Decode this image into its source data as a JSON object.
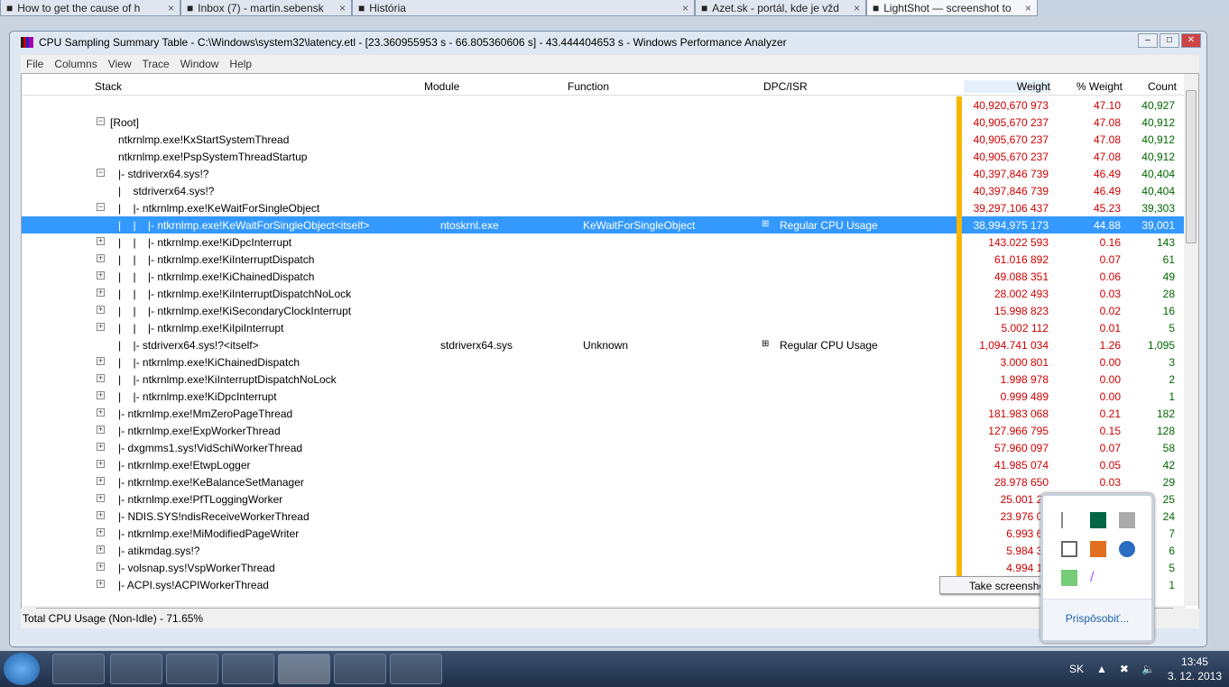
{
  "browser_tabs": [
    "How to get the cause of h",
    "Inbox (7) - martin.sebensk",
    "História",
    "Azet.sk - portál, kde je vžd",
    "LightShot — screenshot to"
  ],
  "window": {
    "title": "CPU Sampling Summary Table - C:\\Windows\\system32\\latency.etl - [23.360955953 s - 66.805360606 s] - 43.444404653 s - Windows Performance Analyzer"
  },
  "menu": [
    "File",
    "Columns",
    "View",
    "Trace",
    "Window",
    "Help"
  ],
  "columns": {
    "stack": "Stack",
    "module": "Module",
    "function": "Function",
    "dpc": "DPC/ISR",
    "weight": "Weight",
    "pweight": "% Weight",
    "count": "Count"
  },
  "rows": [
    {
      "exp": "",
      "stack": "",
      "module": "",
      "function": "",
      "dpc": "",
      "weight": "40,920,670 973",
      "pweight": "47.10",
      "count": "40,927"
    },
    {
      "exp": "−",
      "stack": "[Root]",
      "module": "",
      "function": "",
      "dpc": "",
      "weight": "40,905,670 237",
      "pweight": "47.08",
      "count": "40,912"
    },
    {
      "exp": "",
      "stack": "ntkrnlmp.exe!KxStartSystemThread",
      "module": "",
      "function": "",
      "dpc": "",
      "weight": "40,905,670 237",
      "pweight": "47.08",
      "count": "40,912"
    },
    {
      "exp": "",
      "stack": "ntkrnlmp.exe!PspSystemThreadStartup",
      "module": "",
      "function": "",
      "dpc": "",
      "weight": "40,905,670 237",
      "pweight": "47.08",
      "count": "40,912"
    },
    {
      "exp": "−",
      "stack": "|- stdriverx64.sys!?",
      "module": "",
      "function": "",
      "dpc": "",
      "weight": "40,397,846 739",
      "pweight": "46.49",
      "count": "40,404"
    },
    {
      "exp": "",
      "stack": "|    stdriverx64.sys!?",
      "module": "",
      "function": "",
      "dpc": "",
      "weight": "40,397,846 739",
      "pweight": "46.49",
      "count": "40,404"
    },
    {
      "exp": "−",
      "stack": "|    |- ntkrnlmp.exe!KeWaitForSingleObject",
      "module": "",
      "function": "",
      "dpc": "",
      "weight": "39,297,106 437",
      "pweight": "45.23",
      "count": "39,303"
    },
    {
      "exp": "",
      "stack": "|    |    |- ntkrnlmp.exe!KeWaitForSingleObject<itself>",
      "module": "ntoskrnl.exe",
      "function": "KeWaitForSingleObject",
      "dpc": "Regular CPU Usage",
      "weight": "38,994,975 173",
      "pweight": "44.88",
      "count": "39,001",
      "selected": true
    },
    {
      "exp": "+",
      "stack": "|    |    |- ntkrnlmp.exe!KiDpcInterrupt",
      "module": "",
      "function": "",
      "dpc": "",
      "weight": "143.022 593",
      "pweight": "0.16",
      "count": "143"
    },
    {
      "exp": "+",
      "stack": "|    |    |- ntkrnlmp.exe!KiInterruptDispatch",
      "module": "",
      "function": "",
      "dpc": "",
      "weight": "61.016 892",
      "pweight": "0.07",
      "count": "61"
    },
    {
      "exp": "+",
      "stack": "|    |    |- ntkrnlmp.exe!KiChainedDispatch",
      "module": "",
      "function": "",
      "dpc": "",
      "weight": "49.088 351",
      "pweight": "0.06",
      "count": "49"
    },
    {
      "exp": "+",
      "stack": "|    |    |- ntkrnlmp.exe!KiInterruptDispatchNoLock",
      "module": "",
      "function": "",
      "dpc": "",
      "weight": "28.002 493",
      "pweight": "0.03",
      "count": "28"
    },
    {
      "exp": "+",
      "stack": "|    |    |- ntkrnlmp.exe!KiSecondaryClockInterrupt",
      "module": "",
      "function": "",
      "dpc": "",
      "weight": "15.998 823",
      "pweight": "0.02",
      "count": "16"
    },
    {
      "exp": "+",
      "stack": "|    |    |- ntkrnlmp.exe!KiIpiInterrupt",
      "module": "",
      "function": "",
      "dpc": "",
      "weight": "5.002 112",
      "pweight": "0.01",
      "count": "5"
    },
    {
      "exp": "",
      "stack": "|    |- stdriverx64.sys!?<itself>",
      "module": "stdriverx64.sys",
      "function": "Unknown",
      "dpc": "Regular CPU Usage",
      "weight": "1,094.741 034",
      "pweight": "1.26",
      "count": "1,095"
    },
    {
      "exp": "+",
      "stack": "|    |- ntkrnlmp.exe!KiChainedDispatch",
      "module": "",
      "function": "",
      "dpc": "",
      "weight": "3.000 801",
      "pweight": "0.00",
      "count": "3"
    },
    {
      "exp": "+",
      "stack": "|    |- ntkrnlmp.exe!KiInterruptDispatchNoLock",
      "module": "",
      "function": "",
      "dpc": "",
      "weight": "1.998 978",
      "pweight": "0.00",
      "count": "2"
    },
    {
      "exp": "+",
      "stack": "|    |- ntkrnlmp.exe!KiDpcInterrupt",
      "module": "",
      "function": "",
      "dpc": "",
      "weight": "0.999 489",
      "pweight": "0.00",
      "count": "1"
    },
    {
      "exp": "+",
      "stack": "|- ntkrnlmp.exe!MmZeroPageThread",
      "module": "",
      "function": "",
      "dpc": "",
      "weight": "181.983 068",
      "pweight": "0.21",
      "count": "182"
    },
    {
      "exp": "+",
      "stack": "|- ntkrnlmp.exe!ExpWorkerThread",
      "module": "",
      "function": "",
      "dpc": "",
      "weight": "127.966 795",
      "pweight": "0.15",
      "count": "128"
    },
    {
      "exp": "+",
      "stack": "|- dxgmms1.sys!VidSchiWorkerThread",
      "module": "",
      "function": "",
      "dpc": "",
      "weight": "57.960 097",
      "pweight": "0.07",
      "count": "58"
    },
    {
      "exp": "+",
      "stack": "|- ntkrnlmp.exe!EtwpLogger",
      "module": "",
      "function": "",
      "dpc": "",
      "weight": "41.985 074",
      "pweight": "0.05",
      "count": "42"
    },
    {
      "exp": "+",
      "stack": "|- ntkrnlmp.exe!KeBalanceSetManager",
      "module": "",
      "function": "",
      "dpc": "",
      "weight": "28.978 650",
      "pweight": "0.03",
      "count": "29"
    },
    {
      "exp": "+",
      "stack": "|- ntkrnlmp.exe!PfTLoggingWorker",
      "module": "",
      "function": "",
      "dpc": "",
      "weight": "25.001 22",
      "pweight": "",
      "count": "25"
    },
    {
      "exp": "+",
      "stack": "|- NDIS.SYS!ndisReceiveWorkerThread",
      "module": "",
      "function": "",
      "dpc": "",
      "weight": "23.976 07",
      "pweight": "",
      "count": "24"
    },
    {
      "exp": "+",
      "stack": "|- ntkrnlmp.exe!MiModifiedPageWriter",
      "module": "",
      "function": "",
      "dpc": "",
      "weight": "6.993 62",
      "pweight": "",
      "count": "7"
    },
    {
      "exp": "+",
      "stack": "|- atikmdag.sys!?",
      "module": "",
      "function": "",
      "dpc": "",
      "weight": "5.984 33",
      "pweight": "",
      "count": "6"
    },
    {
      "exp": "+",
      "stack": "|- volsnap.sys!VspWorkerThread",
      "module": "",
      "function": "",
      "dpc": "",
      "weight": "4.994 18",
      "pweight": "",
      "count": "5"
    },
    {
      "exp": "+",
      "stack": "|- ACPI.sys!ACPIWorkerThread",
      "module": "",
      "function": "",
      "dpc": "",
      "weight": "",
      "pweight": "",
      "count": "1"
    }
  ],
  "status": "Total CPU Usage (Non-Idle) - 71.65%",
  "tray_popup": {
    "customize": "Prispôsobiť...",
    "tooltip": "Take screenshot"
  },
  "taskbar": {
    "lang": "SK",
    "time": "13:45",
    "date": "3. 12. 2013"
  },
  "colors": {
    "selection": "#3399ff",
    "weight_text": "#cc0000",
    "count_text": "#006600",
    "bar": "#f7b500"
  }
}
